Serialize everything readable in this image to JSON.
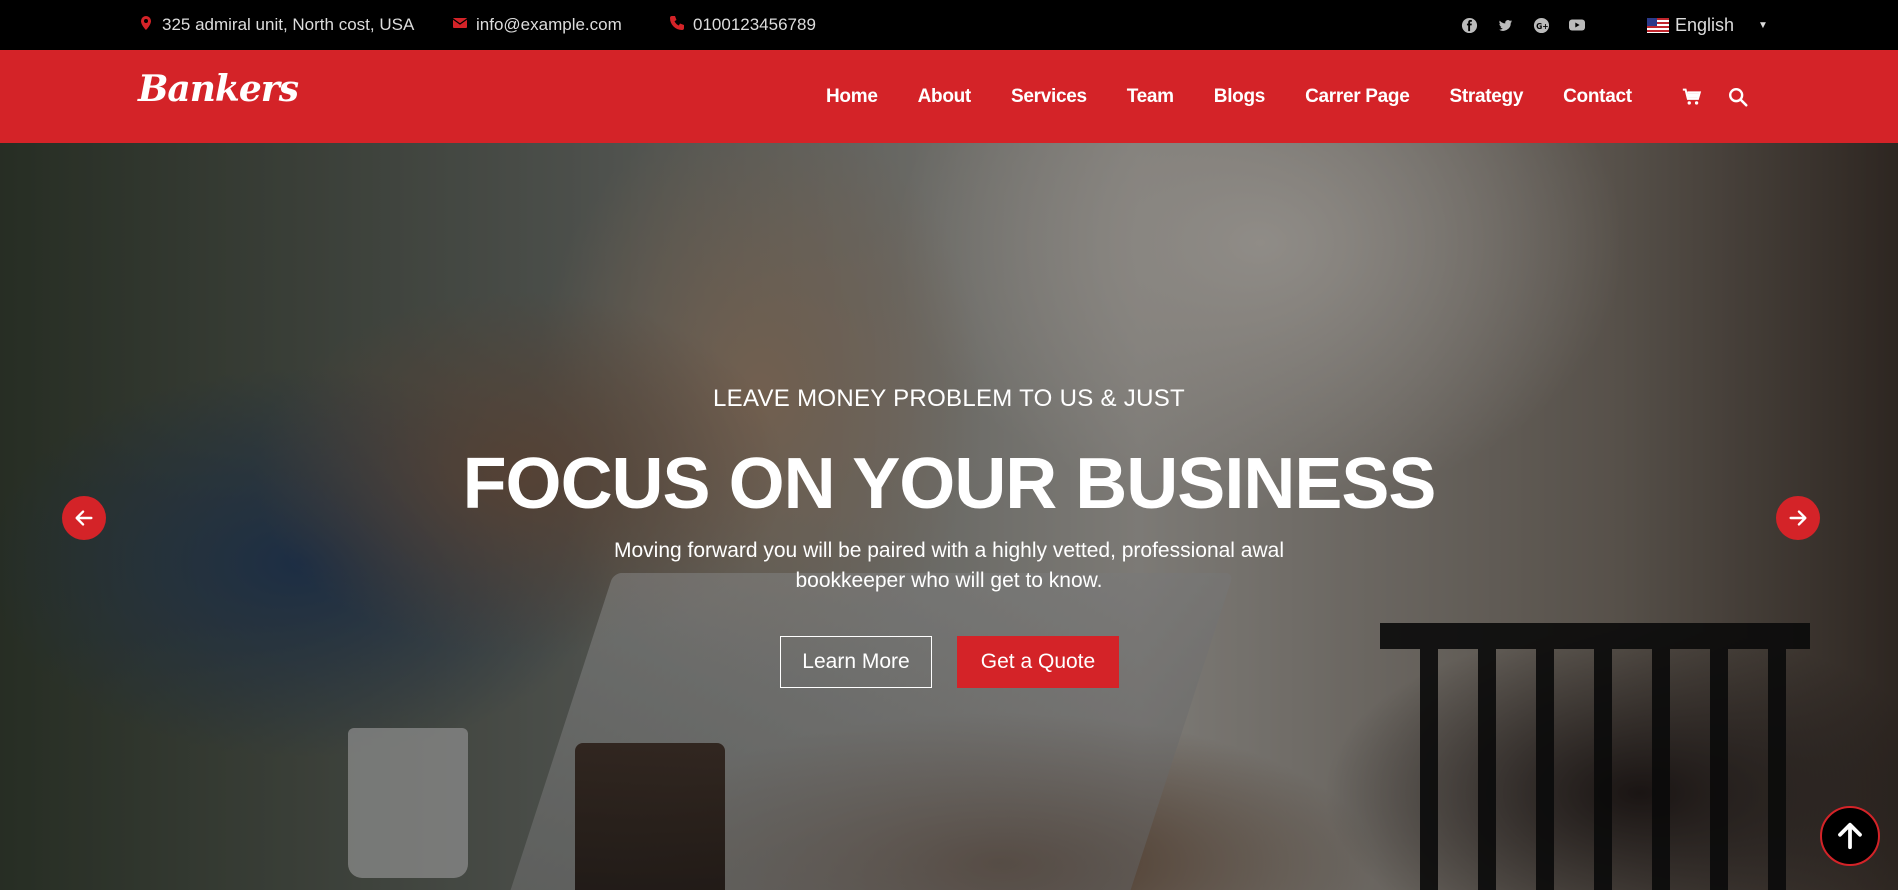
{
  "topbar": {
    "address": "325 admiral unit, North cost, USA",
    "email": "info@example.com",
    "phone": "0100123456789",
    "socials": [
      "facebook-icon",
      "twitter-icon",
      "google-plus-icon",
      "youtube-icon"
    ],
    "language": "English"
  },
  "nav": {
    "logo": "Bankers",
    "links": [
      "Home",
      "About",
      "Services",
      "Team",
      "Blogs",
      "Carrer Page",
      "Strategy",
      "Contact"
    ],
    "icons": [
      "cart-icon",
      "search-icon"
    ]
  },
  "hero": {
    "subtitle": "LEAVE MONEY PROBLEM TO US & JUST",
    "title": "FOCUS ON YOUR BUSINESS",
    "description": "Moving forward you will be paired with a highly vetted, professional awal bookkeeper who will get to know.",
    "learn_more": "Learn More",
    "get_quote": "Get a Quote"
  },
  "colors": {
    "accent": "#d42328",
    "topbar_bg": "#000000"
  }
}
